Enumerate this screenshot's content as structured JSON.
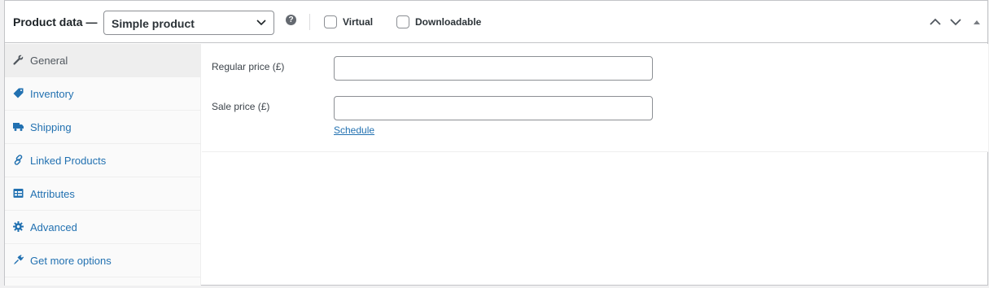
{
  "header": {
    "title": "Product data —",
    "product_type": "Simple product",
    "help_glyph": "?",
    "virtual_label": "Virtual",
    "downloadable_label": "Downloadable"
  },
  "tabs": [
    {
      "label": "General",
      "icon": "wrench-icon",
      "active": true
    },
    {
      "label": "Inventory",
      "icon": "tag-icon",
      "active": false
    },
    {
      "label": "Shipping",
      "icon": "truck-icon",
      "active": false
    },
    {
      "label": "Linked Products",
      "icon": "link-icon",
      "active": false
    },
    {
      "label": "Attributes",
      "icon": "list-icon",
      "active": false
    },
    {
      "label": "Advanced",
      "icon": "gear-icon",
      "active": false
    },
    {
      "label": "Get more options",
      "icon": "plug-icon",
      "active": false
    }
  ],
  "general": {
    "regular_price_label": "Regular price (£)",
    "regular_price_value": "",
    "sale_price_label": "Sale price (£)",
    "sale_price_value": "",
    "schedule_link": "Schedule"
  },
  "colors": {
    "link": "#2271b1",
    "border": "#c3c4c7",
    "tab_bg": "#fafafa",
    "active_tab_bg": "#eeeeee"
  }
}
